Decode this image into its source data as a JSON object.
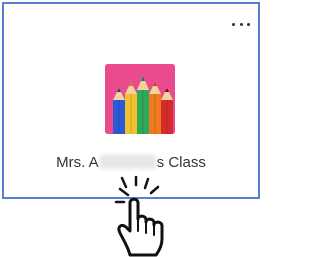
{
  "card": {
    "more_label": "...",
    "class_name_prefix": "Mrs. A",
    "class_name_suffix": "s Class",
    "image_icon": "pencils-icon",
    "colors": {
      "border": "#5b7fcf",
      "image_bg": "#e94b8e"
    }
  },
  "overlay": {
    "icon": "hand-pointer-click-icon"
  }
}
